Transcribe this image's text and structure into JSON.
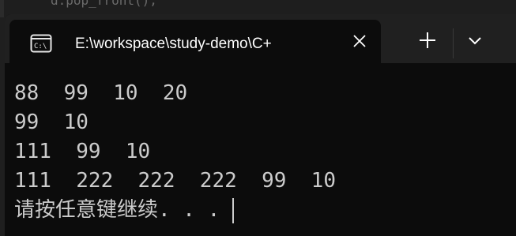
{
  "background_code": {
    "text": "d.pop_front();"
  },
  "window": {
    "tab": {
      "icon": "terminal-console-icon",
      "title": "E:\\workspace\\study-demo\\C+",
      "close_icon": "close-icon"
    },
    "new_tab_icon": "plus-icon",
    "dropdown_icon": "chevron-down-icon"
  },
  "terminal": {
    "lines": [
      "88  99  10  20",
      "99  10",
      "111  99  10",
      "111  222  222  222  99  10"
    ],
    "prompt": "请按任意键继续. . ."
  },
  "colors": {
    "terminal_bg": "#0c0c0c",
    "titlebar_bg": "#202020",
    "terminal_text": "#cccccc",
    "title_text": "#ffffff"
  }
}
